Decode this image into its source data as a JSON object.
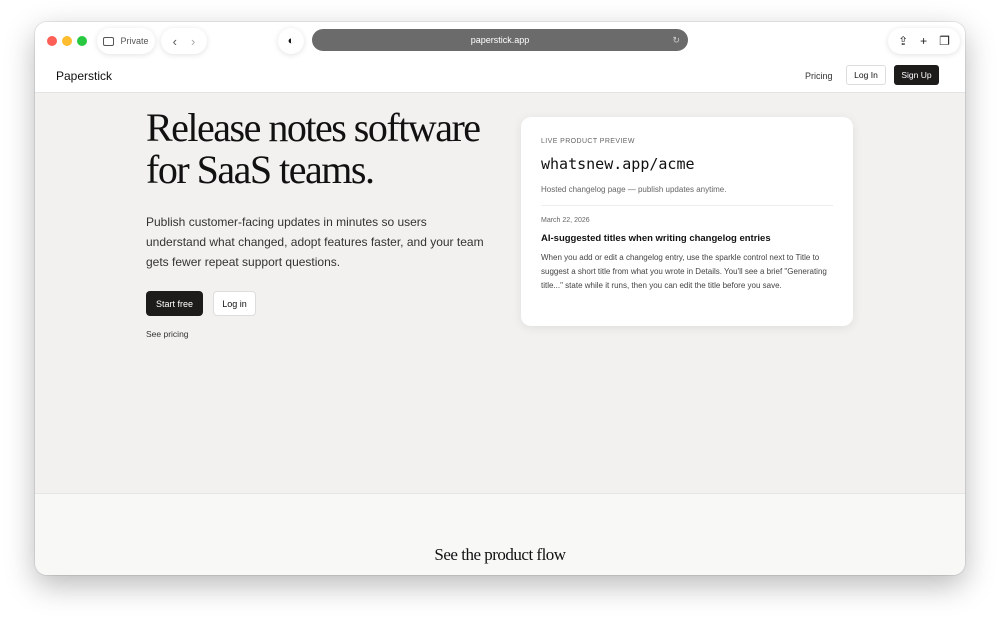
{
  "browser": {
    "private_label": "Private",
    "url": "paperstick.app"
  },
  "nav": {
    "brand": "Paperstick",
    "pricing": "Pricing",
    "login": "Log In",
    "signup": "Sign Up"
  },
  "hero": {
    "title": "Release notes software for SaaS teams.",
    "subtitle": "Publish customer-facing updates in minutes so users understand what changed, adopt features faster, and your team gets fewer repeat support questions.",
    "start": "Start free",
    "login": "Log in",
    "see_pricing": "See pricing"
  },
  "preview": {
    "label": "LIVE PRODUCT PREVIEW",
    "url": "whatsnew.app/acme",
    "description": "Hosted changelog page — publish updates anytime.",
    "date": "March 22, 2026",
    "entry_title": "AI-suggested titles when writing changelog entries",
    "entry_body": "When you add or edit a changelog entry, use the sparkle control next to Title to suggest a short title from what you wrote in Details. You'll see a brief \"Generating title...\" state while it runs, then you can edit the title before you save."
  },
  "section2": {
    "title": "See the product flow"
  }
}
